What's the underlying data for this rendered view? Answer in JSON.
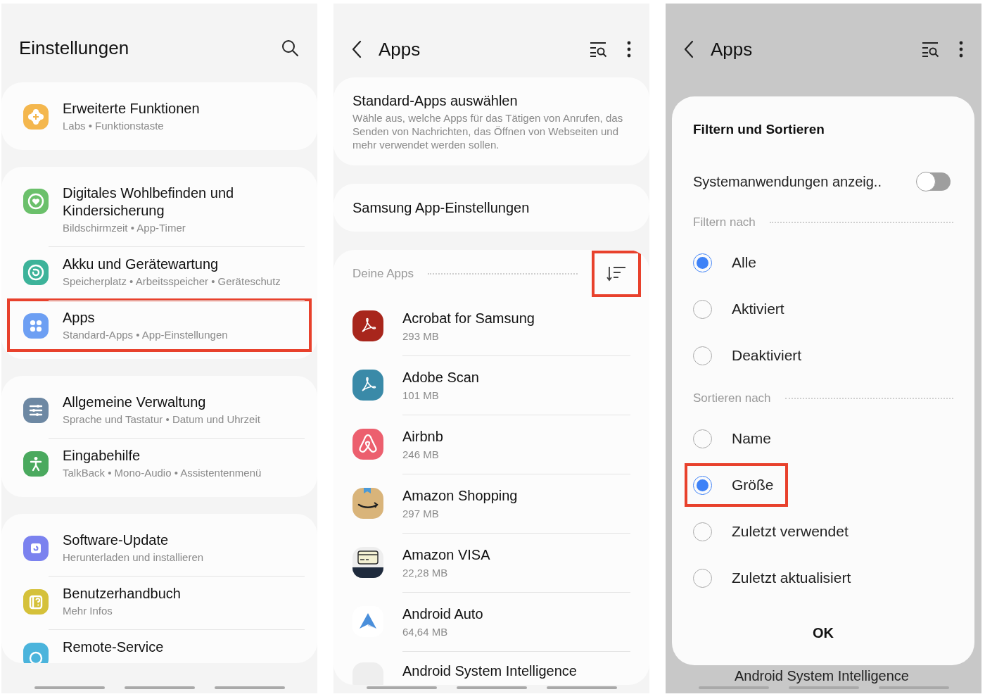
{
  "settings_screen": {
    "title": "Einstellungen",
    "groups": [
      {
        "items": [
          {
            "title": "Erweiterte Funktionen",
            "subtitle": "Labs • Funktionstaste",
            "color": "#f4b74e",
            "highlighted": false
          }
        ]
      },
      {
        "items": [
          {
            "title": "Digitales Wohlbefinden und Kindersicherung",
            "subtitle": "Bildschirmzeit • App-Timer",
            "color": "#6bc06b",
            "highlighted": false
          },
          {
            "title": "Akku und Gerätewartung",
            "subtitle": "Speicherplatz • Arbeitsspeicher • Geräteschutz",
            "color": "#3db39a",
            "highlighted": false
          },
          {
            "title": "Apps",
            "subtitle": "Standard-Apps • App-Einstellungen",
            "color": "#6d9ff3",
            "highlighted": true
          }
        ]
      },
      {
        "items": [
          {
            "title": "Allgemeine Verwaltung",
            "subtitle": "Sprache und Tastatur • Datum und Uhrzeit",
            "color": "#6d88a3",
            "highlighted": false
          },
          {
            "title": "Eingabehilfe",
            "subtitle": "TalkBack • Mono-Audio • Assistentenmenü",
            "color": "#4aa95e",
            "highlighted": false
          }
        ]
      },
      {
        "items": [
          {
            "title": "Software-Update",
            "subtitle": "Herunterladen und installieren",
            "color": "#7b82ef",
            "highlighted": false
          },
          {
            "title": "Benutzerhandbuch",
            "subtitle": "Mehr Infos",
            "color": "#d5c13a",
            "highlighted": false
          },
          {
            "title": "Remote-Service",
            "color": "#4bb4dc",
            "highlighted": false
          }
        ]
      }
    ]
  },
  "apps_screen": {
    "title": "Apps",
    "cards": [
      {
        "title": "Standard-Apps auswählen",
        "subtitle": "Wähle aus, welche Apps für das Tätigen von Anrufen, das Senden von Nachrichten, das Öffnen von Webseiten und mehr verwendet werden sollen."
      },
      {
        "title": "Samsung App-Einstellungen"
      }
    ],
    "section_label": "Deine Apps",
    "sort_highlighted": true,
    "apps": [
      {
        "name": "Acrobat for Samsung",
        "size": "293 MB"
      },
      {
        "name": "Adobe Scan",
        "size": "101 MB"
      },
      {
        "name": "Airbnb",
        "size": "246 MB"
      },
      {
        "name": "Amazon Shopping",
        "size": "297 MB"
      },
      {
        "name": "Amazon VISA",
        "size": "22,28 MB"
      },
      {
        "name": "Android Auto",
        "size": "64,64 MB"
      },
      {
        "name": "Android System Intelligence"
      }
    ]
  },
  "filter_screen": {
    "title": "Apps",
    "background_text": "Android System Intelligence",
    "sheet": {
      "title": "Filtern und Sortieren",
      "toggle": {
        "label": "Systemanwendungen anzeig..",
        "on": false
      },
      "filter_label": "Filtern nach",
      "filter_options": [
        {
          "label": "Alle",
          "selected": true,
          "highlighted": false
        },
        {
          "label": "Aktiviert",
          "selected": false,
          "highlighted": false
        },
        {
          "label": "Deaktiviert",
          "selected": false,
          "highlighted": false
        }
      ],
      "sort_label": "Sortieren nach",
      "sort_options": [
        {
          "label": "Name",
          "selected": false,
          "highlighted": false
        },
        {
          "label": "Größe",
          "selected": true,
          "highlighted": true
        },
        {
          "label": "Zuletzt verwendet",
          "selected": false,
          "highlighted": false
        },
        {
          "label": "Zuletzt aktualisiert",
          "selected": false,
          "highlighted": false
        }
      ],
      "ok": "OK"
    }
  }
}
